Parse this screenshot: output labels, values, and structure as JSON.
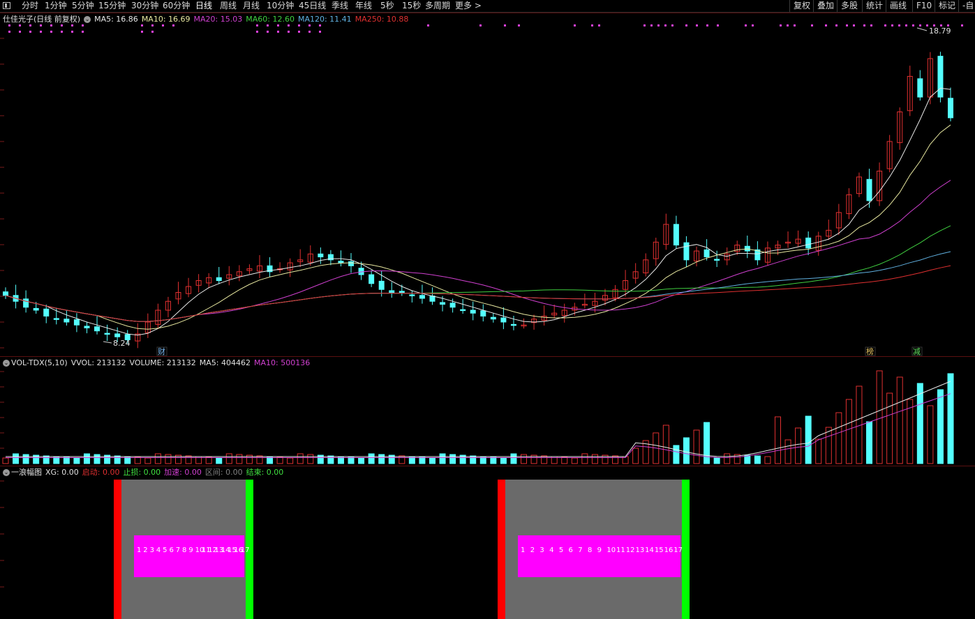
{
  "toolbar": {
    "periods": [
      "分时",
      "1分钟",
      "5分钟",
      "15分钟",
      "30分钟",
      "60分钟",
      "日线",
      "周线",
      "月线",
      "10分钟",
      "45日线",
      "季线",
      "年线",
      "5秒",
      "15秒",
      "多周期",
      "更多 >"
    ],
    "active_period": "日线",
    "right_buttons": [
      "复权",
      "叠加",
      "多股",
      "统计",
      "画线",
      "F10",
      "标记",
      "-自"
    ]
  },
  "main_pane": {
    "title": "仕佳光子(日线 前复权)",
    "indicators": [
      {
        "label": "MA5: 16.86",
        "color": "#e8e8e8"
      },
      {
        "label": "MA10: 16.69",
        "color": "#e8e8a0"
      },
      {
        "label": "MA20: 15.03",
        "color": "#d040d0"
      },
      {
        "label": "MA60: 12.60",
        "color": "#40d040"
      },
      {
        "label": "MA120: 11.41",
        "color": "#60b0e0"
      },
      {
        "label": "MA250: 10.88",
        "color": "#e03030"
      }
    ],
    "high_label": "18.79",
    "low_label": "8.24",
    "markers": [
      {
        "label": "财",
        "color": "#7ab8f0"
      },
      {
        "label": "榜",
        "color": "#e0c060"
      },
      {
        "label": "减",
        "color": "#60e060"
      }
    ]
  },
  "volume_pane": {
    "title": "VOL-TDX(5,10)",
    "values": [
      {
        "label": "VVOL: 213132",
        "color": "#e0e0e0"
      },
      {
        "label": "VOLUME: 213132",
        "color": "#e0e0e0"
      },
      {
        "label": "MA5: 404462",
        "color": "#e0e0e0"
      },
      {
        "label": "MA10: 500136",
        "color": "#d040d0"
      }
    ]
  },
  "wave_pane": {
    "title": "一浪幅图",
    "values": [
      {
        "label": "XG: 0.00",
        "color": "#e0e0e0"
      },
      {
        "label": "启动: 0.00",
        "color": "#e03030"
      },
      {
        "label": "止损: 0.00",
        "color": "#40e040"
      },
      {
        "label": "加速: 0.00",
        "color": "#d040d0"
      },
      {
        "label": "区间: 0.00",
        "color": "#808080"
      },
      {
        "label": "结束: 0.00",
        "color": "#40e040"
      }
    ],
    "count_labels": [
      "1",
      "2",
      "3",
      "4",
      "5",
      "6",
      "7",
      "8",
      "9",
      "10",
      "11",
      "12",
      "13",
      "14",
      "15",
      "16",
      "17"
    ]
  },
  "colors": {
    "up": "#e03030",
    "down": "#54ffff",
    "grid": "#7a1a1a",
    "magenta": "#ff00ff",
    "gray": "#6a6a6a",
    "red": "#ff0000",
    "green": "#00ff00"
  },
  "chart_data": {
    "type": "candlestick",
    "ma_series": [
      "MA5",
      "MA10",
      "MA20",
      "MA60",
      "MA120",
      "MA250"
    ],
    "price_range": [
      8.24,
      18.79
    ],
    "closes": [
      9.8,
      9.6,
      9.4,
      9.3,
      9.1,
      9.0,
      8.9,
      8.8,
      8.7,
      8.6,
      8.5,
      8.4,
      8.3,
      8.5,
      8.9,
      9.3,
      9.6,
      9.9,
      10.1,
      10.3,
      10.4,
      10.3,
      10.5,
      10.6,
      10.7,
      10.8,
      10.6,
      10.7,
      10.9,
      11.0,
      11.2,
      11.1,
      11.0,
      10.9,
      10.8,
      10.5,
      10.2,
      10.0,
      9.9,
      9.9,
      9.8,
      9.7,
      9.6,
      9.5,
      9.4,
      9.3,
      9.2,
      9.1,
      9.0,
      8.9,
      8.8,
      8.8,
      9.0,
      9.1,
      9.2,
      9.3,
      9.4,
      9.5,
      9.6,
      9.8,
      10.0,
      10.3,
      10.6,
      11.0,
      11.6,
      12.2,
      11.5,
      11.0,
      11.3,
      11.1,
      11.0,
      11.2,
      11.5,
      11.3,
      11.0,
      11.4,
      11.5,
      11.6,
      11.7,
      11.4,
      11.8,
      12.0,
      12.6,
      13.2,
      13.8,
      13.0,
      14.0,
      15.0,
      16.0,
      17.2,
      16.5,
      17.8,
      16.5,
      15.8
    ],
    "volume": {
      "ma5": 404462,
      "ma10": 500136,
      "last": 213132
    }
  }
}
